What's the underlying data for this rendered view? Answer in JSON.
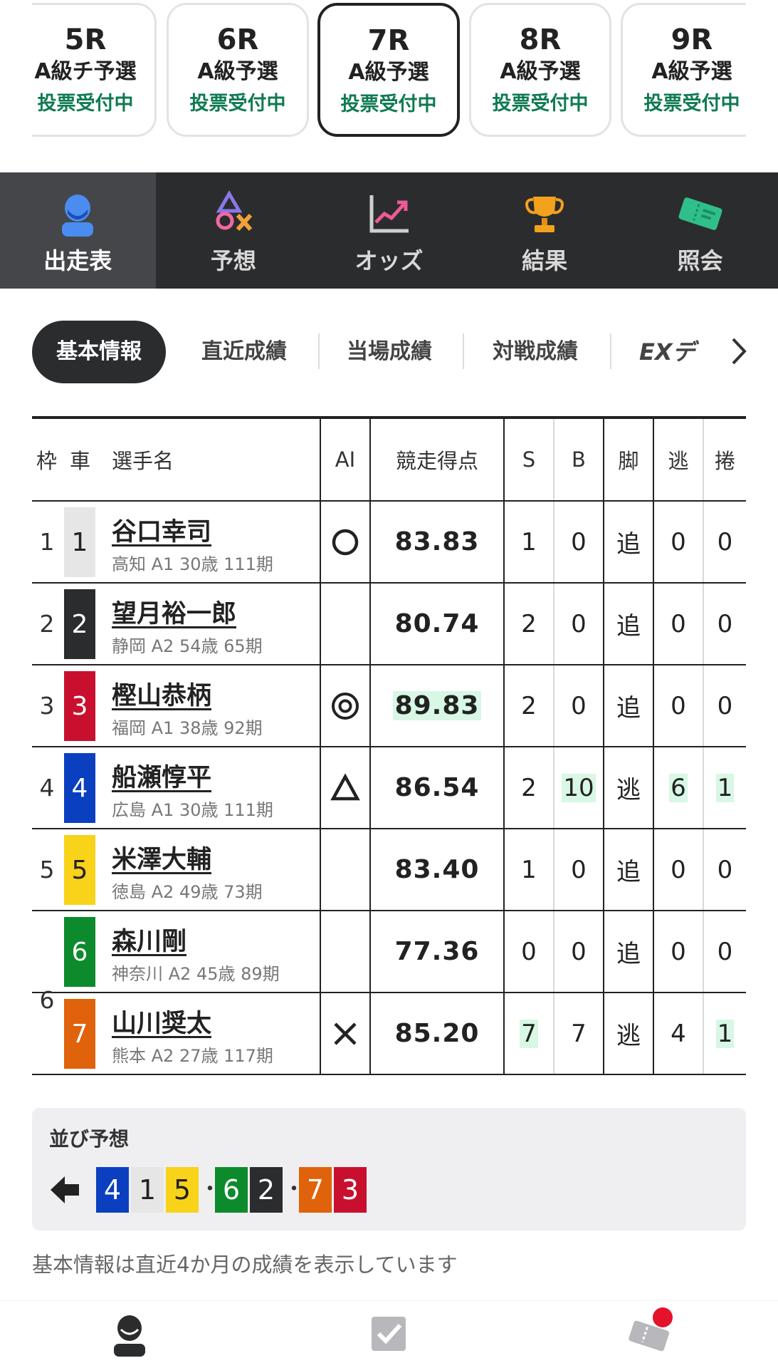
{
  "race_tabs": [
    {
      "race": "5R",
      "class": "A級チ予選",
      "status": "投票受付中",
      "active": false
    },
    {
      "race": "6R",
      "class": "A級予選",
      "status": "投票受付中",
      "active": false
    },
    {
      "race": "7R",
      "class": "A級予選",
      "status": "投票受付中",
      "active": true
    },
    {
      "race": "8R",
      "class": "A級予選",
      "status": "投票受付中",
      "active": false
    },
    {
      "race": "9R",
      "class": "A級予選",
      "status": "投票受付中",
      "active": false
    }
  ],
  "main_nav": [
    {
      "label": "出走表",
      "icon": "racer-icon",
      "active": true
    },
    {
      "label": "予想",
      "icon": "prediction-icon",
      "active": false
    },
    {
      "label": "オッズ",
      "icon": "odds-chart-icon",
      "active": false
    },
    {
      "label": "結果",
      "icon": "trophy-icon",
      "active": false
    },
    {
      "label": "照会",
      "icon": "ticket-icon",
      "active": false
    }
  ],
  "sub_tabs": [
    "基本情報",
    "直近成績",
    "当場成績",
    "対戦成績",
    "EXデ"
  ],
  "table": {
    "headers": {
      "waku": "枠",
      "car": "車",
      "name": "選手名",
      "ai": "AI",
      "score": "競走得点",
      "s": "S",
      "b": "B",
      "leg": "脚",
      "nige": "逃",
      "makuri": "捲"
    },
    "rows": [
      {
        "waku": "1",
        "car": "1",
        "name": "谷口幸司",
        "info": "高知 A1 30歳 111期",
        "ai": "circle",
        "score": "83.83",
        "s": "1",
        "b": "0",
        "leg": "追",
        "nige": "0",
        "makuri": "0"
      },
      {
        "waku": "2",
        "car": "2",
        "name": "望月裕一郎",
        "info": "静岡 A2 54歳 65期",
        "ai": "",
        "score": "80.74",
        "s": "2",
        "b": "0",
        "leg": "追",
        "nige": "0",
        "makuri": "0"
      },
      {
        "waku": "3",
        "car": "3",
        "name": "樫山恭柄",
        "info": "福岡 A1 38歳 92期",
        "ai": "double-circle",
        "score": "89.83",
        "s": "2",
        "b": "0",
        "leg": "追",
        "nige": "0",
        "makuri": "0"
      },
      {
        "waku": "4",
        "car": "4",
        "name": "船瀬惇平",
        "info": "広島 A1 30歳 111期",
        "ai": "triangle",
        "score": "86.54",
        "s": "2",
        "b": "10",
        "leg": "逃",
        "nige": "6",
        "makuri": "1"
      },
      {
        "waku": "5",
        "car": "5",
        "name": "米澤大輔",
        "info": "徳島 A2 49歳 73期",
        "ai": "",
        "score": "83.40",
        "s": "1",
        "b": "0",
        "leg": "追",
        "nige": "0",
        "makuri": "0"
      },
      {
        "waku": "6",
        "car": "6",
        "name": "森川剛",
        "info": "神奈川 A2 45歳 89期",
        "ai": "",
        "score": "77.36",
        "s": "0",
        "b": "0",
        "leg": "追",
        "nige": "0",
        "makuri": "0"
      },
      {
        "waku": "",
        "car": "7",
        "name": "山川奨太",
        "info": "熊本 A2 27歳 117期",
        "ai": "cross",
        "score": "85.20",
        "s": "7",
        "b": "7",
        "leg": "逃",
        "nige": "4",
        "makuri": "1"
      }
    ]
  },
  "narabi": {
    "title": "並び予想",
    "groups": [
      [
        "4",
        "1",
        "5"
      ],
      [
        "6",
        "2"
      ],
      [
        "7",
        "3"
      ]
    ],
    "separator": "・"
  },
  "note": "基本情報は直近4か月の成績を表示しています",
  "colors": {
    "car1": "#e6e6e6",
    "car2": "#2b2c2e",
    "car3": "#c8102e",
    "car4": "#0a3fbf",
    "car5": "#f9d21a",
    "car6": "#0c8a2c",
    "car7": "#e0620a",
    "highlight": "#d8f7e4",
    "status_green": "#0f7a52",
    "nav_bg": "#2b2c2e"
  },
  "bottom_nav": [
    "racer-icon",
    "checkbox-icon",
    "ticket-icon"
  ]
}
